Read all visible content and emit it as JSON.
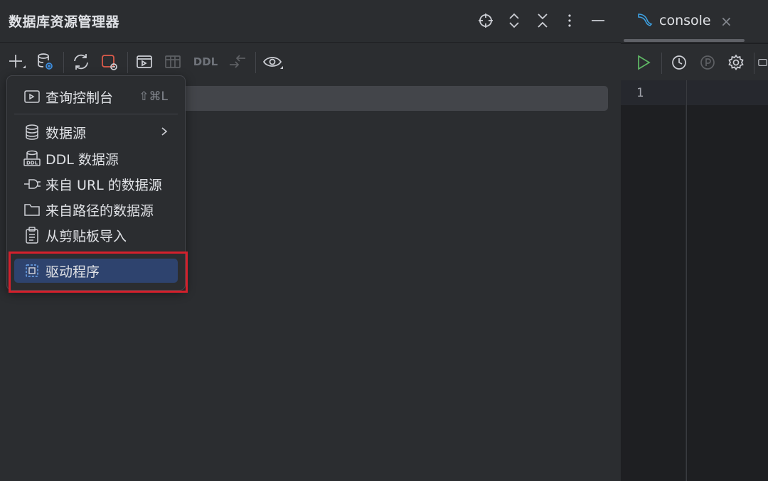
{
  "panel": {
    "title": "数据库资源管理器"
  },
  "toolbar": {
    "ddl_label": "DDL"
  },
  "popup_menu": {
    "items": [
      {
        "label": "查询控制台",
        "shortcut": "⇧⌘L",
        "icon": "console-icon"
      },
      {
        "label": "数据源",
        "icon": "database-icon",
        "submenu": true
      },
      {
        "label": "DDL 数据源",
        "icon": "ddl-database-icon"
      },
      {
        "label": "来自 URL 的数据源",
        "icon": "plug-icon"
      },
      {
        "label": "来自路径的数据源",
        "icon": "folder-icon"
      },
      {
        "label": "从剪贴板导入",
        "icon": "clipboard-icon"
      },
      {
        "label": "驱动程序",
        "icon": "driver-icon",
        "selected": true
      }
    ]
  },
  "editor": {
    "tab_label": "console",
    "tab_close": "×",
    "line_number": "1"
  },
  "colors": {
    "accent_selected": "#2e436e",
    "highlight_box": "#d4202c",
    "run_green": "#5fb865",
    "mysql_blue": "#3d9fe0"
  }
}
